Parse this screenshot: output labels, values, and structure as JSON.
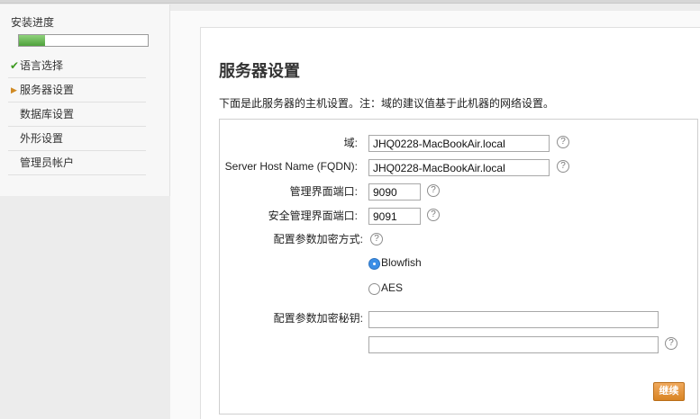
{
  "sidebar": {
    "title": "安装进度",
    "progress_percent": 20,
    "steps": [
      {
        "label": "语言选择",
        "state": "done"
      },
      {
        "label": "服务器设置",
        "state": "current"
      },
      {
        "label": "数据库设置",
        "state": "pending"
      },
      {
        "label": "外形设置",
        "state": "pending"
      },
      {
        "label": "管理员帐户",
        "state": "pending"
      }
    ]
  },
  "main": {
    "title": "服务器设置",
    "intro": "下面是此服务器的主机设置。注：域的建议值基于此机器的网络设置。",
    "fields": {
      "domain": {
        "label": "域:",
        "value": "JHQ0228-MacBookAir.local"
      },
      "fqdn": {
        "label": "Server Host Name (FQDN):",
        "value": "JHQ0228-MacBookAir.local"
      },
      "admin_port": {
        "label": "管理界面端口:",
        "value": "9090"
      },
      "secure_admin_port": {
        "label": "安全管理界面端口:",
        "value": "9091"
      },
      "encryption_method": {
        "label": "配置参数加密方式:",
        "options": [
          "Blowfish",
          "AES"
        ],
        "selected": "Blowfish"
      },
      "encryption_key": {
        "label": "配置参数加密秘钥:",
        "value": "",
        "confirm_value": ""
      }
    },
    "help_glyph": "?",
    "continue_label": "继续"
  },
  "colors": {
    "accent_button": "#d98423",
    "progress_green": "#4fa23c",
    "radio_selected": "#3b8ee6"
  }
}
